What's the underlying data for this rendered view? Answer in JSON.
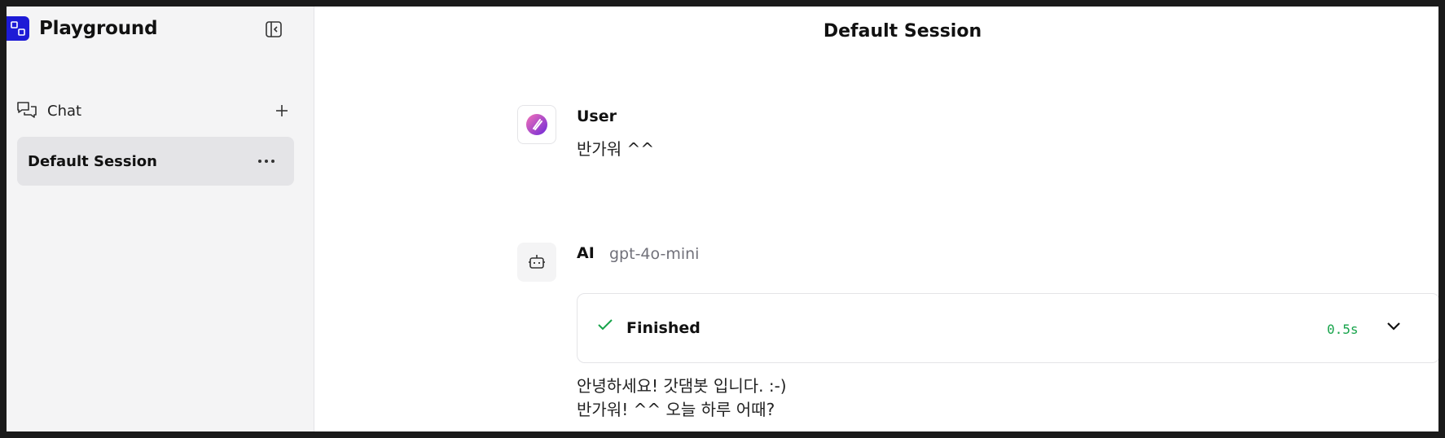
{
  "sidebar": {
    "app_title": "Playground",
    "nav": {
      "chat_label": "Chat"
    },
    "sessions": [
      {
        "label": "Default Session"
      }
    ]
  },
  "main": {
    "title": "Default Session",
    "messages": [
      {
        "role": "User",
        "text": "반가워 ^^"
      },
      {
        "role": "AI",
        "model": "gpt-4o-mini",
        "step": {
          "status": "Finished",
          "duration": "0.5s"
        },
        "lines": [
          "안녕하세요! 갓댐봇 입니다. :-)",
          "반가워! ^^ 오늘 하루 어때?"
        ]
      }
    ]
  },
  "colors": {
    "brand": "#1d1bd6",
    "success": "#16a34a",
    "sidebar_bg": "#f4f4f5",
    "selected_bg": "#e4e4e7"
  },
  "icons": {
    "brand": "playground-logo-icon",
    "collapse": "sidebar-collapse-icon",
    "chat": "chat-bubbles-icon",
    "add": "plus-icon",
    "more": "more-horizontal-icon",
    "user_avatar": "user-avatar-icon",
    "ai_avatar": "robot-icon",
    "check": "check-icon",
    "expand": "chevron-down-icon"
  }
}
